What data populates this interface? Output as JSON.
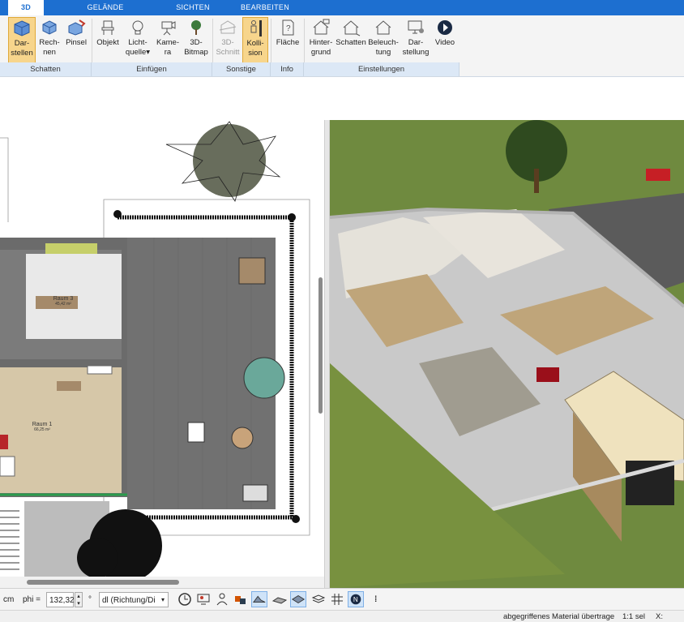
{
  "tabs": [
    {
      "label": "3D",
      "active": true
    },
    {
      "label": "GELÄNDE",
      "active": false
    },
    {
      "label": "SICHTEN",
      "active": false
    },
    {
      "label": "BEARBEITEN",
      "active": false
    }
  ],
  "ribbon": {
    "buttons": {
      "darstellen": {
        "l1": "Dar-",
        "l2": "stellen"
      },
      "rechnen": {
        "l1": "Rech-",
        "l2": "nen"
      },
      "pinsel": {
        "l1": "Pinsel",
        "l2": ""
      },
      "objekt": {
        "l1": "Objekt",
        "l2": ""
      },
      "lichtquelle": {
        "l1": "Licht-",
        "l2": "quelle"
      },
      "kamera": {
        "l1": "Kame-",
        "l2": "ra"
      },
      "bitmap": {
        "l1": "3D-",
        "l2": "Bitmap"
      },
      "schnitt": {
        "l1": "3D-",
        "l2": "Schnitt"
      },
      "kollision": {
        "l1": "Kolli-",
        "l2": "sion"
      },
      "flaeche": {
        "l1": "Fläche",
        "l2": ""
      },
      "hintergrund": {
        "l1": "Hinter-",
        "l2": "grund"
      },
      "schatten": {
        "l1": "Schatten",
        "l2": ""
      },
      "beleuchtung": {
        "l1": "Beleuch-",
        "l2": "tung"
      },
      "darstellung": {
        "l1": "Dar-",
        "l2": "stellung"
      },
      "video": {
        "l1": "Video",
        "l2": ""
      }
    },
    "groups": {
      "schatten": "Schatten",
      "einfuegen": "Einfügen",
      "sonstige": "Sonstige",
      "info": "Info",
      "einstellungen": "Einstellungen"
    }
  },
  "plan": {
    "room1": {
      "name": "Raum 1",
      "area": "66,25 m²"
    },
    "room3": {
      "name": "Raum 3",
      "area": "45,42 m²"
    }
  },
  "bottom": {
    "unit": "cm",
    "phi_label": "phi =",
    "phi_value": "132,32",
    "deg": "°",
    "dl_value": "dl (Richtung/Di"
  },
  "status": {
    "message": "abgegriffenes Material übertrage",
    "scale": "1:1 sel",
    "x_label": "X:"
  },
  "colors": {
    "accent": "#1d6fd0",
    "selected": "#f7d58c",
    "grass": "#6f8a3f"
  }
}
